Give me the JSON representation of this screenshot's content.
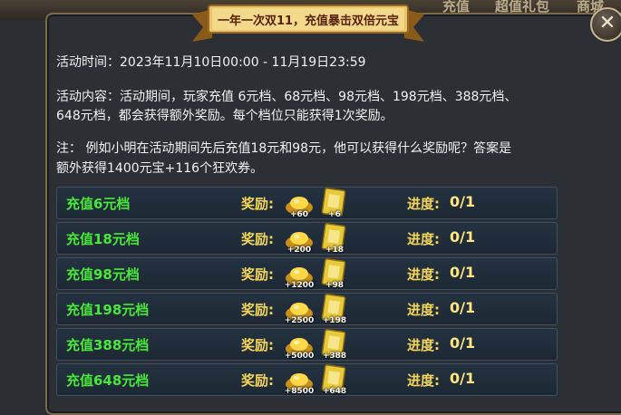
{
  "top_tabs": [
    "充值",
    "超值礼包",
    "商城"
  ],
  "banner_title": "一年一次双11，充值暴击双倍元宝",
  "close_glyph": "✕",
  "activity_time": "活动时间：2023年11月10日00:00 - 11月19日23:59",
  "activity_content_line1": "活动内容：活动期间，玩家充值 6元档、68元档、98元档、198元档、388元档、",
  "activity_content_line2": "648元档，都会获得额外奖励。每个档位只能获得1次奖励。",
  "note_line1": "注：  例如小明在活动期间先后充值18元和98元，他可以获得什么奖励呢？答案是",
  "note_line2": "额外获得1400元宝+116个狂欢券。",
  "reward_label": "奖励:",
  "progress_label": "进度:",
  "rows": [
    {
      "name": "充值6元档",
      "gold": "+60",
      "tickets": "+6",
      "progress": "0/1"
    },
    {
      "name": "充值18元档",
      "gold": "+200",
      "tickets": "+18",
      "progress": "0/1"
    },
    {
      "name": "充值98元档",
      "gold": "+1200",
      "tickets": "+98",
      "progress": "0/1"
    },
    {
      "name": "充值198元档",
      "gold": "+2500",
      "tickets": "+198",
      "progress": "0/1"
    },
    {
      "name": "充值388元档",
      "gold": "+5000",
      "tickets": "+388",
      "progress": "0/1"
    },
    {
      "name": "充值648元档",
      "gold": "+8500",
      "tickets": "+648",
      "progress": "0/1"
    }
  ],
  "icons": {
    "gold": "gold-ingot-icon",
    "ticket": "carnival-ticket-icon",
    "close": "close-icon"
  },
  "colors": {
    "row_name": "#48e83a",
    "label": "#f3d55a",
    "banner_text": "#5a2208"
  }
}
